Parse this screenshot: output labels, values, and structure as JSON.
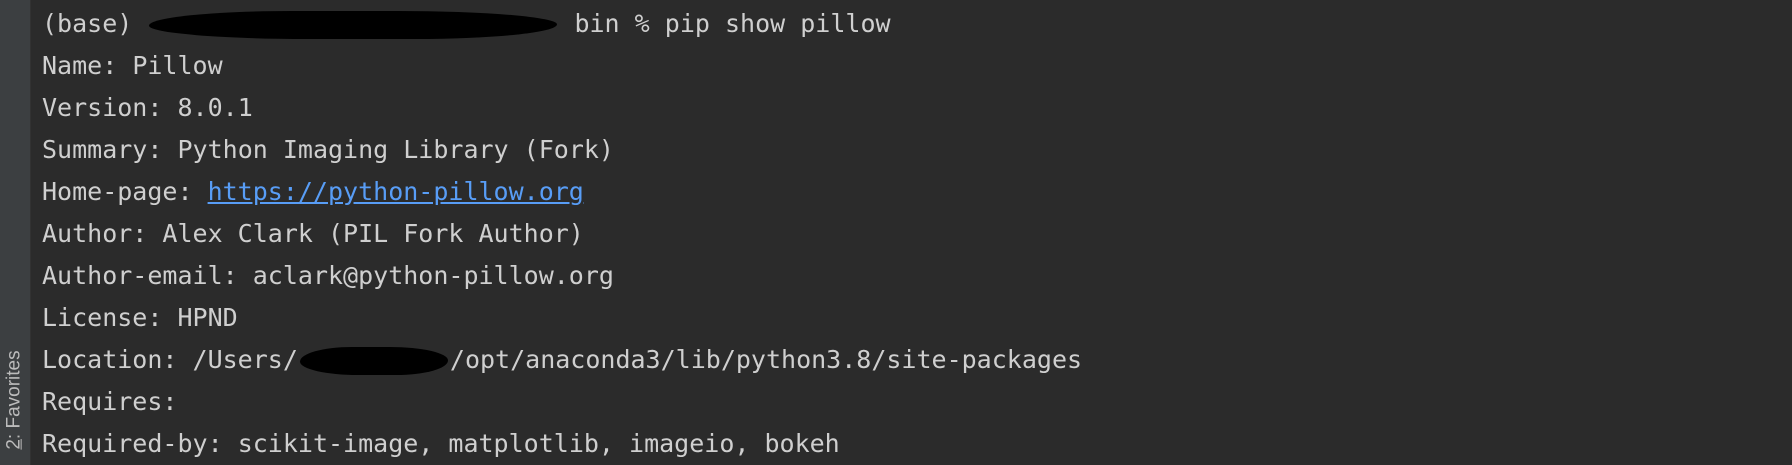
{
  "sidebar": {
    "favorites_number": "2",
    "favorites_text": ": Favorites"
  },
  "terminal": {
    "prompt_env": "(base)",
    "prompt_dir": "bin",
    "prompt_symbol": "%",
    "command": "pip show pillow",
    "fields": {
      "name": {
        "key": "Name:",
        "value": "Pillow"
      },
      "version": {
        "key": "Version:",
        "value": "8.0.1"
      },
      "summary": {
        "key": "Summary:",
        "value": "Python Imaging Library (Fork)"
      },
      "homepage": {
        "key": "Home-page:",
        "value": "https://python-pillow.org"
      },
      "author": {
        "key": "Author:",
        "value": "Alex Clark (PIL Fork Author)"
      },
      "author_email": {
        "key": "Author-email:",
        "value": "aclark@python-pillow.org"
      },
      "license": {
        "key": "License:",
        "value": "HPND"
      },
      "location": {
        "key": "Location:",
        "prefix": "/Users/",
        "suffix": "/opt/anaconda3/lib/python3.8/site-packages"
      },
      "requires": {
        "key": "Requires:",
        "value": ""
      },
      "required_by": {
        "key": "Required-by:",
        "value": "scikit-image, matplotlib, imageio, bokeh"
      }
    }
  },
  "colors": {
    "background": "#2b2b2b",
    "text": "#cfcfcf",
    "link": "#589df6",
    "redaction": "#000000"
  }
}
